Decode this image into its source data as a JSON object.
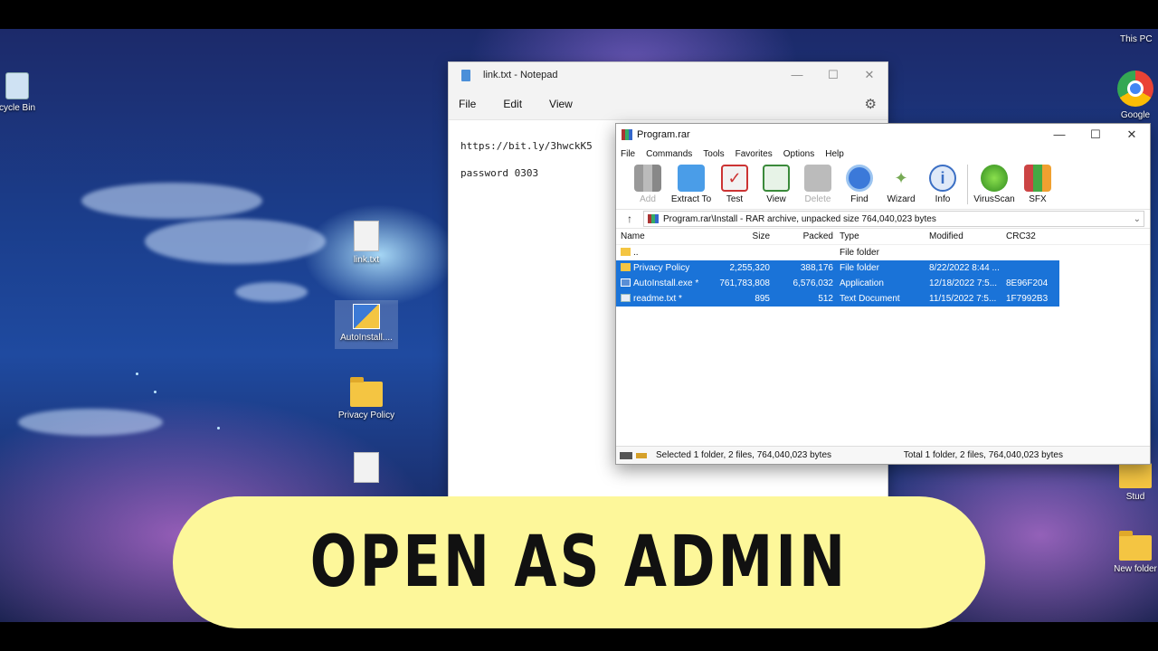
{
  "desktop": {
    "this_pc_label": "This PC",
    "recycle_bin_label": "cycle Bin",
    "google_label": "Google",
    "link_txt_label": "link.txt",
    "autoinstall_label": "AutoInstall....",
    "privacy_policy_label": "Privacy Policy",
    "stud_label": "Stud",
    "new_folder_label": "New folder"
  },
  "notepad": {
    "title": "link.txt - Notepad",
    "menu": [
      "File",
      "Edit",
      "View"
    ],
    "lines": [
      "https://bit.ly/3hwckK5",
      "password 0303"
    ]
  },
  "winrar": {
    "title": "Program.rar",
    "menu": [
      "File",
      "Commands",
      "Tools",
      "Favorites",
      "Options",
      "Help"
    ],
    "toolbar": [
      {
        "label": "Add",
        "icon": "add-icon",
        "enabled": false
      },
      {
        "label": "Extract To",
        "icon": "extract-icon",
        "enabled": true
      },
      {
        "label": "Test",
        "icon": "test-icon",
        "enabled": true
      },
      {
        "label": "View",
        "icon": "view-icon",
        "enabled": true
      },
      {
        "label": "Delete",
        "icon": "delete-icon",
        "enabled": false
      },
      {
        "label": "Find",
        "icon": "find-icon",
        "enabled": true
      },
      {
        "label": "Wizard",
        "icon": "wizard-icon",
        "enabled": true
      },
      {
        "label": "Info",
        "icon": "info-icon",
        "enabled": true
      },
      {
        "label": "VirusScan",
        "icon": "virusscan-icon",
        "enabled": true
      },
      {
        "label": "SFX",
        "icon": "sfx-icon",
        "enabled": true
      }
    ],
    "path": "Program.rar\\Install - RAR archive, unpacked size 764,040,023 bytes",
    "columns": {
      "name": "Name",
      "size": "Size",
      "packed": "Packed",
      "type": "Type",
      "modified": "Modified",
      "crc": "CRC32"
    },
    "rows": [
      {
        "name": "..",
        "size": "",
        "packed": "",
        "type": "File folder",
        "modified": "",
        "crc": "",
        "icon": "folder",
        "selected": false
      },
      {
        "name": "Privacy Policy",
        "size": "2,255,320",
        "packed": "388,176",
        "type": "File folder",
        "modified": "8/22/2022 8:44 ...",
        "crc": "",
        "icon": "folder",
        "selected": true
      },
      {
        "name": "AutoInstall.exe *",
        "size": "761,783,808",
        "packed": "6,576,032",
        "type": "Application",
        "modified": "12/18/2022 7:5...",
        "crc": "8E96F204",
        "icon": "exe",
        "selected": true
      },
      {
        "name": "readme.txt *",
        "size": "895",
        "packed": "512",
        "type": "Text Document",
        "modified": "11/15/2022 7:5...",
        "crc": "1F7992B3",
        "icon": "txt",
        "selected": true
      }
    ],
    "status_left": "Selected 1 folder, 2 files, 764,040,023 bytes",
    "status_right": "Total 1 folder, 2 files, 764,040,023 bytes"
  },
  "banner": {
    "text": "OPEN AS ADMIN"
  },
  "colors": {
    "selection": "#1a73d8",
    "banner": "#fdf79a"
  }
}
